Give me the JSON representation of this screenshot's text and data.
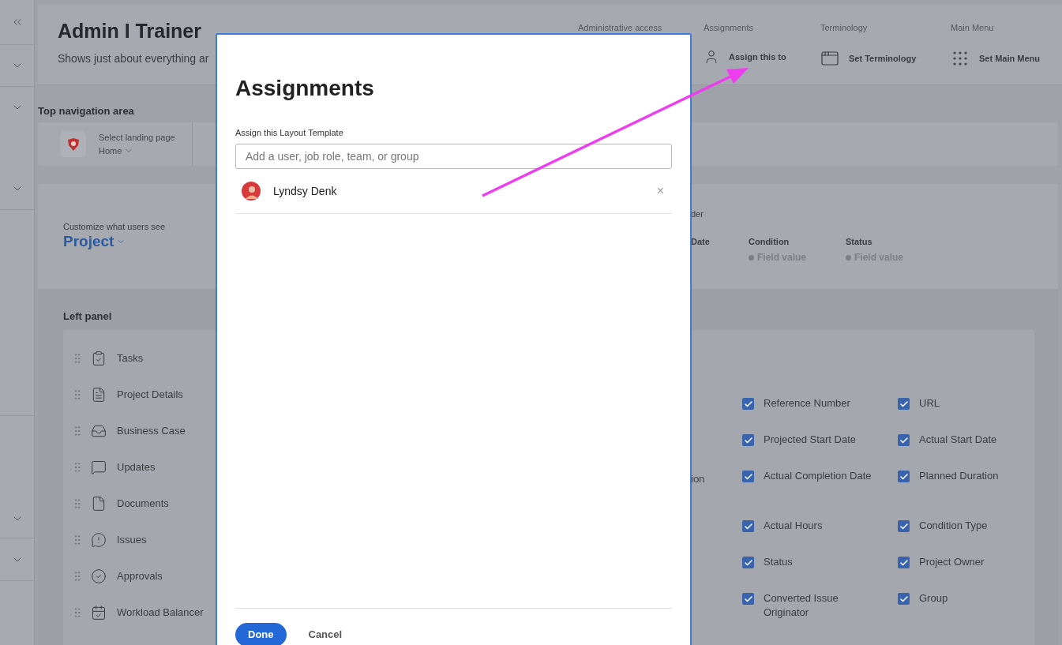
{
  "header": {
    "title": "Admin I Trainer",
    "subtitle": "Shows just about everything ar",
    "actions": [
      {
        "label": "Administrative access"
      },
      {
        "label": "Assignments",
        "button": "Assign this to",
        "kind": "user"
      },
      {
        "label": "Terminology",
        "button": "Set Terminology",
        "kind": "window"
      },
      {
        "label": "Main Menu",
        "button": "Set Main Menu",
        "kind": "grid"
      }
    ]
  },
  "top_navigation": {
    "heading": "Top navigation area",
    "landing_label": "Select landing page",
    "landing_value": "Home"
  },
  "customize": {
    "label": "Customize what users see",
    "object": "Project",
    "fragment": "der",
    "fields": [
      {
        "label": "Date"
      },
      {
        "label": "Condition",
        "value": "Field value"
      },
      {
        "label": "Status",
        "value": "Field value"
      }
    ]
  },
  "left_panel": {
    "heading": "Left panel",
    "items": [
      {
        "label": "Tasks",
        "kind": "tasks"
      },
      {
        "label": "Project Details",
        "kind": "details"
      },
      {
        "label": "Business Case",
        "kind": "business"
      },
      {
        "label": "Updates",
        "kind": "updates"
      },
      {
        "label": "Documents",
        "kind": "documents"
      },
      {
        "label": "Issues",
        "kind": "issues"
      },
      {
        "label": "Approvals",
        "kind": "approvals"
      },
      {
        "label": "Workload Balancer",
        "kind": "workload"
      }
    ],
    "fragment": "ion",
    "option_rows": [
      [
        {
          "label": "Reference Number",
          "checked": true
        },
        {
          "label": "URL",
          "checked": true
        }
      ],
      [
        {
          "label": "Projected Start Date",
          "checked": true
        },
        {
          "label": "Actual Start Date",
          "checked": true
        }
      ],
      [
        {
          "label": "Actual Completion Date",
          "checked": true
        },
        {
          "label": "Planned Duration",
          "checked": true
        }
      ],
      [
        {
          "label": "Actual Hours",
          "checked": true
        },
        {
          "label": "Condition Type",
          "checked": true
        }
      ],
      [
        {
          "label": "Status",
          "checked": true
        },
        {
          "label": "Project Owner",
          "checked": true
        }
      ],
      [
        {
          "label": "Converted Issue Originator",
          "checked": true
        },
        {
          "label": "Group",
          "checked": true
        }
      ]
    ]
  },
  "dialog": {
    "title": "Assignments",
    "field_label": "Assign this Layout Template",
    "placeholder": "Add a user, job role, team, or group",
    "assignees": [
      {
        "name": "Lyndsy Denk",
        "remove": "×"
      }
    ],
    "buttons": [
      {
        "label": "Done",
        "kind": "primary"
      },
      {
        "label": "Cancel",
        "kind": "secondary"
      }
    ]
  }
}
